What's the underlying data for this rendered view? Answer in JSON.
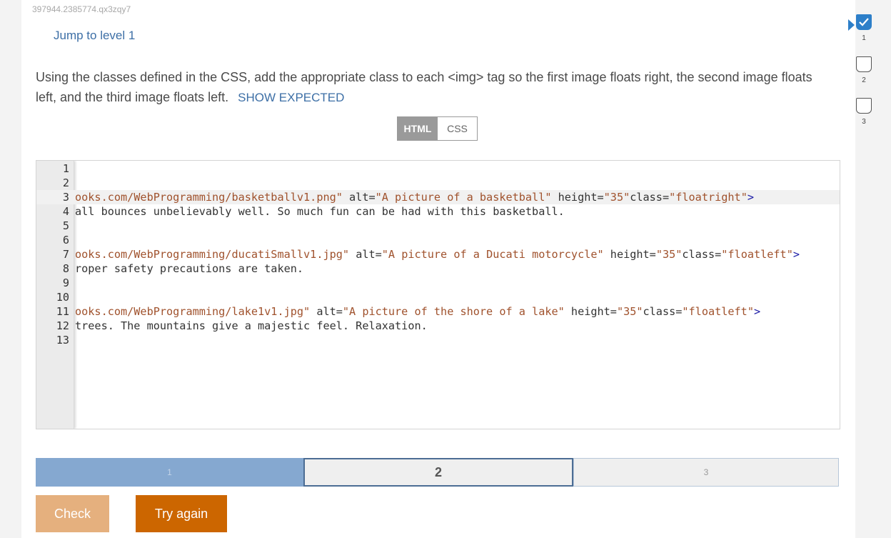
{
  "activity": {
    "id": "397944.2385774.qx3zqy7"
  },
  "jump_link": "Jump to level 1",
  "instructions": {
    "text": "Using the classes defined in the CSS, add the appropriate class to each <img> tag so the first image floats right, the second image floats left, and the third image floats left.",
    "show_expected": "SHOW EXPECTED"
  },
  "tabs": [
    {
      "label": "HTML",
      "active": true
    },
    {
      "label": "CSS",
      "active": false
    }
  ],
  "editor": {
    "lines": [
      {
        "n": "1",
        "tokens": []
      },
      {
        "n": "2",
        "tokens": []
      },
      {
        "n": "3",
        "active": true,
        "tokens": [
          {
            "t": "str",
            "v": "ooks.com/WebProgramming/basketballv1.png\""
          },
          {
            "t": "attr",
            "v": " alt="
          },
          {
            "t": "str",
            "v": "\"A picture of a basketball\""
          },
          {
            "t": "attr",
            "v": " height="
          },
          {
            "t": "str",
            "v": "\"35\""
          },
          {
            "t": "attr",
            "v": "class="
          },
          {
            "t": "str",
            "v": "\"floatright\""
          },
          {
            "t": "tag",
            "v": ">"
          }
        ]
      },
      {
        "n": "4",
        "tokens": [
          {
            "t": "attr",
            "v": "all bounces unbelievably well. So much fun can be had with this basketball."
          }
        ]
      },
      {
        "n": "5",
        "tokens": []
      },
      {
        "n": "6",
        "tokens": []
      },
      {
        "n": "7",
        "tokens": [
          {
            "t": "str",
            "v": "ooks.com/WebProgramming/ducatiSmallv1.jpg\""
          },
          {
            "t": "attr",
            "v": " alt="
          },
          {
            "t": "str",
            "v": "\"A picture of a Ducati motorcycle\""
          },
          {
            "t": "attr",
            "v": " height="
          },
          {
            "t": "str",
            "v": "\"35\""
          },
          {
            "t": "attr",
            "v": "class="
          },
          {
            "t": "str",
            "v": "\"floatleft\""
          },
          {
            "t": "tag",
            "v": ">"
          }
        ]
      },
      {
        "n": "8",
        "tokens": [
          {
            "t": "attr",
            "v": "roper safety precautions are taken."
          }
        ]
      },
      {
        "n": "9",
        "tokens": []
      },
      {
        "n": "10",
        "tokens": []
      },
      {
        "n": "11",
        "tokens": [
          {
            "t": "str",
            "v": "ooks.com/WebProgramming/lake1v1.jpg\""
          },
          {
            "t": "attr",
            "v": " alt="
          },
          {
            "t": "str",
            "v": "\"A picture of the shore of a lake\""
          },
          {
            "t": "attr",
            "v": " height="
          },
          {
            "t": "str",
            "v": "\"35\""
          },
          {
            "t": "attr",
            "v": "class="
          },
          {
            "t": "str",
            "v": "\"floatleft\""
          },
          {
            "t": "tag",
            "v": ">"
          }
        ]
      },
      {
        "n": "12",
        "tokens": [
          {
            "t": "attr",
            "v": "trees. The mountains give a majestic feel. Relaxation."
          }
        ]
      },
      {
        "n": "13",
        "tokens": []
      }
    ]
  },
  "progress": [
    {
      "label": "1",
      "state": "done"
    },
    {
      "label": "2",
      "state": "current"
    },
    {
      "label": "3",
      "state": "todo"
    }
  ],
  "buttons": {
    "check": "Check",
    "try_again": "Try again"
  },
  "levels": [
    {
      "label": "1",
      "done": true
    },
    {
      "label": "2",
      "done": false
    },
    {
      "label": "3",
      "done": false
    }
  ],
  "colors": {
    "accent": "#2d7fc9",
    "link": "#3d6fa6",
    "try_again": "#cc6600",
    "check": "#e5b07e"
  },
  "icons": {
    "level_done": "checkmark-icon",
    "current_level": "triangle-arrow-icon"
  }
}
